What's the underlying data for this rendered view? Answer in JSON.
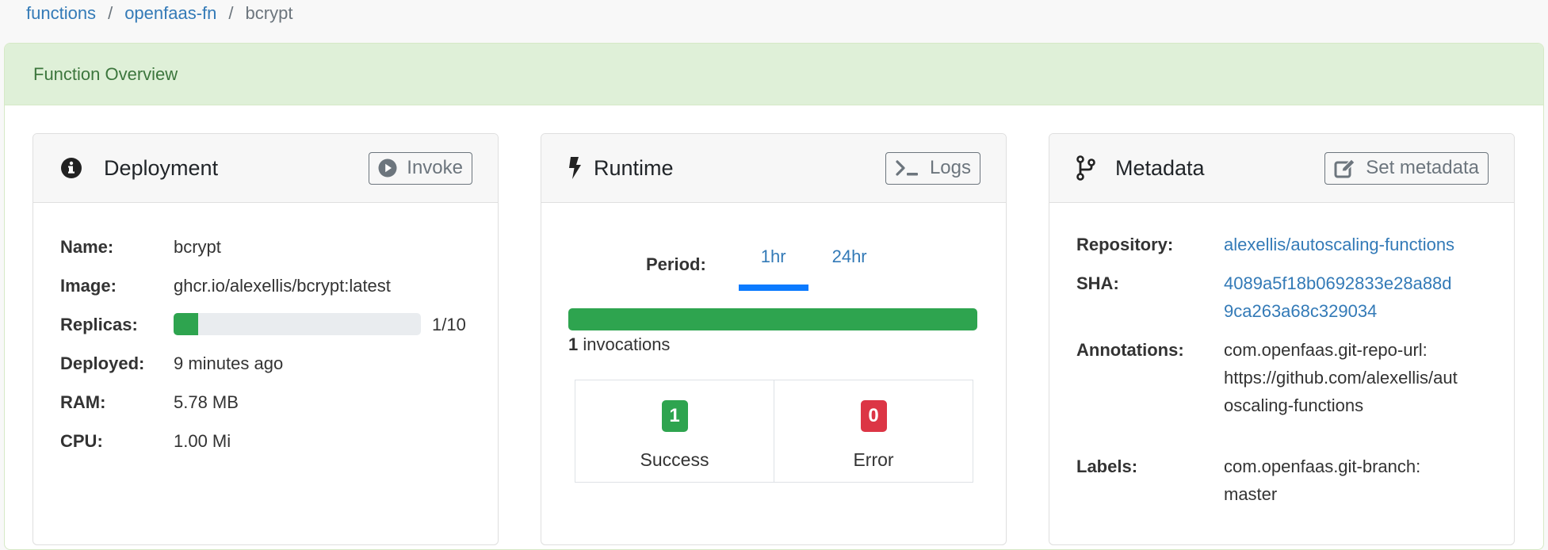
{
  "breadcrumb": {
    "items": [
      {
        "label": "functions",
        "link": true
      },
      {
        "label": "openfaas-fn",
        "link": true
      },
      {
        "label": "bcrypt",
        "link": false
      }
    ],
    "separator": "/"
  },
  "overview": {
    "title": "Function Overview"
  },
  "deployment": {
    "title": "Deployment",
    "icon": "info-circle-icon",
    "invoke_label": "Invoke",
    "fields": {
      "name_label": "Name:",
      "name_value": "bcrypt",
      "image_label": "Image:",
      "image_value": "ghcr.io/alexellis/bcrypt:latest",
      "replicas_label": "Replicas:",
      "replicas_value": "1/10",
      "replicas_current": 1,
      "replicas_max": 10,
      "deployed_label": "Deployed:",
      "deployed_value": "9 minutes ago",
      "ram_label": "RAM:",
      "ram_value": "5.78 MB",
      "cpu_label": "CPU:",
      "cpu_value": "1.00 Mi"
    }
  },
  "runtime": {
    "title": "Runtime",
    "icon": "bolt-icon",
    "logs_label": "Logs",
    "period_label": "Period:",
    "tabs": [
      {
        "label": "1hr",
        "active": true
      },
      {
        "label": "24hr",
        "active": false
      }
    ],
    "invocations_success_fraction": 1.0,
    "invocations_count": "1",
    "invocations_suffix": " invocations",
    "success_count": "1",
    "success_label": "Success",
    "error_count": "0",
    "error_label": "Error"
  },
  "metadata": {
    "title": "Metadata",
    "icon": "code-branch-icon",
    "set_metadata_label": "Set metadata",
    "repository_label": "Repository:",
    "repository_value": "alexellis/autoscaling-functions",
    "sha_label": "SHA:",
    "sha_value_line1": "4089a5f18b0692833e28a88d",
    "sha_value_line2": "9ca263a68c329034",
    "annotations_label": "Annotations:",
    "annotations_line1": "com.openfaas.git-repo-url:",
    "annotations_line2": "https://github.com/alexellis/aut",
    "annotations_line3": "oscaling-functions",
    "labels_label": "Labels:",
    "labels_line1": "com.openfaas.git-branch:",
    "labels_line2": "master"
  },
  "colors": {
    "link": "#337ab7",
    "success": "#2ea44f",
    "danger": "#dc3545",
    "tab_active": "#0b7bff",
    "overview_header_bg": "#dff0d8",
    "overview_header_text": "#3c763d"
  }
}
